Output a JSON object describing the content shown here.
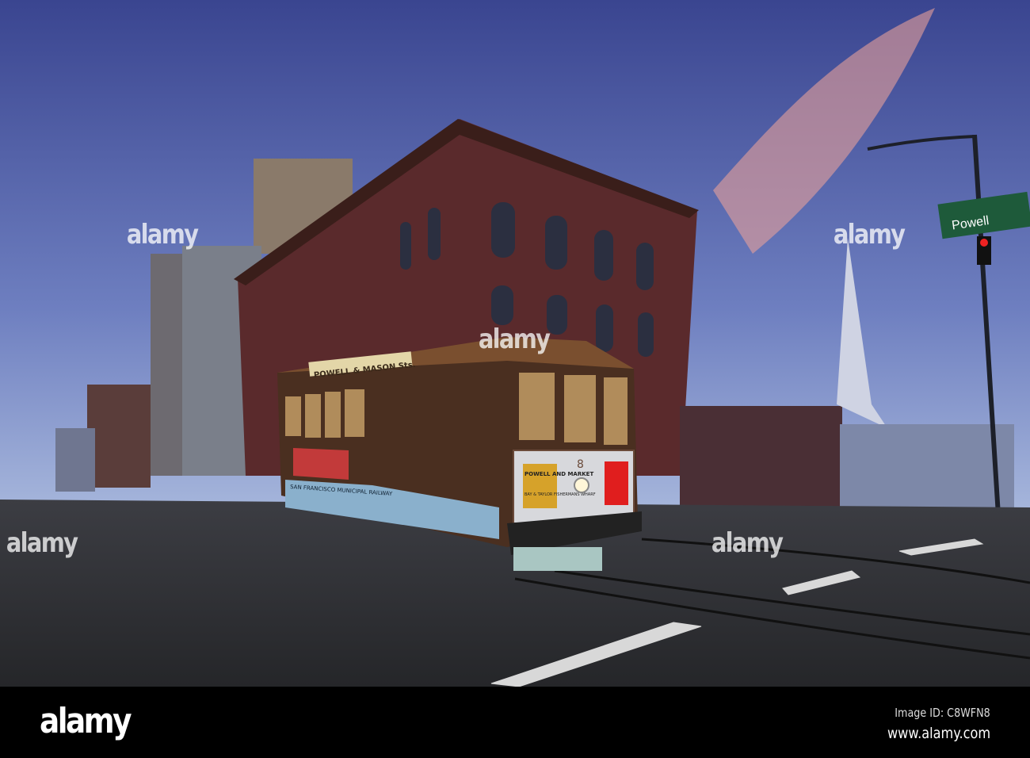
{
  "photo": {
    "street_sign": "Powell",
    "car_roof_sign": "POWELL & MASON Sts.",
    "car_number": "8",
    "destination_sign_top": "POWELL AND MARKET",
    "destination_sign_bottom": "BAY & TAYLOR FISHERMANS WHARF",
    "side_banner": "SAN FRANCISCO MUNICIPAL RAILWAY"
  },
  "watermark": "alamy",
  "footer": {
    "logo": "alamy",
    "image_id": "Image ID: C8WFN8",
    "url": "www.alamy.com"
  },
  "colors": {
    "sky_top": "#3c4a8a",
    "sky_bottom": "#8fa4d0",
    "brick": "#5a2a2a",
    "road": "#2e2f33"
  }
}
